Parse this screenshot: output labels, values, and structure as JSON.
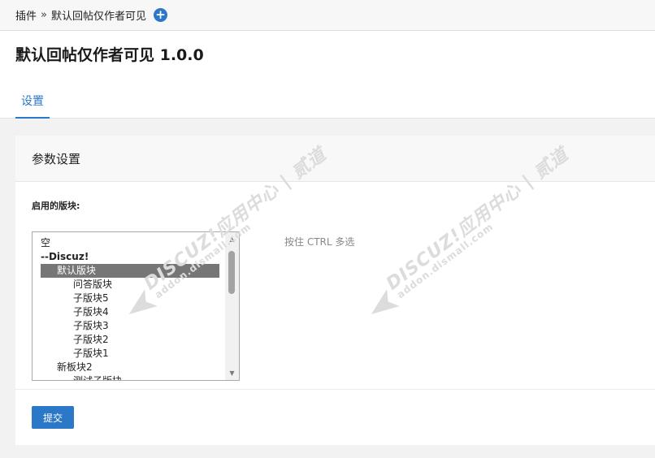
{
  "breadcrumb": {
    "parent": "插件",
    "separator": "»",
    "current": "默认回帖仅作者可见"
  },
  "header": {
    "title": "默认回帖仅作者可见 1.0.0",
    "tabs": [
      {
        "label": "设置",
        "active": true
      }
    ]
  },
  "panel": {
    "title": "参数设置",
    "field_label": "启用的版块:",
    "hint": "按住 CTRL 多选",
    "options": [
      {
        "label": "空",
        "level": 0,
        "bold": false,
        "selected": false
      },
      {
        "label": "--Discuz!",
        "level": 0,
        "bold": true,
        "selected": false
      },
      {
        "label": "默认版块",
        "level": 1,
        "bold": false,
        "selected": true
      },
      {
        "label": "问答版块",
        "level": 2,
        "bold": false,
        "selected": false
      },
      {
        "label": "子版块5",
        "level": 2,
        "bold": false,
        "selected": false
      },
      {
        "label": "子版块4",
        "level": 2,
        "bold": false,
        "selected": false
      },
      {
        "label": "子版块3",
        "level": 2,
        "bold": false,
        "selected": false
      },
      {
        "label": "子版块2",
        "level": 2,
        "bold": false,
        "selected": false
      },
      {
        "label": "子版块1",
        "level": 2,
        "bold": false,
        "selected": false
      },
      {
        "label": "新板块2",
        "level": 1,
        "bold": false,
        "selected": false
      },
      {
        "label": "测试子版块",
        "level": 2,
        "bold": false,
        "selected": false
      }
    ],
    "submit_label": "提交"
  },
  "watermark": {
    "main": "DISCUZ!应用中心 | 贰道",
    "sub": "addon.dismall.com"
  },
  "colors": {
    "accent": "#2b77c8",
    "selected_option": "#767676"
  }
}
